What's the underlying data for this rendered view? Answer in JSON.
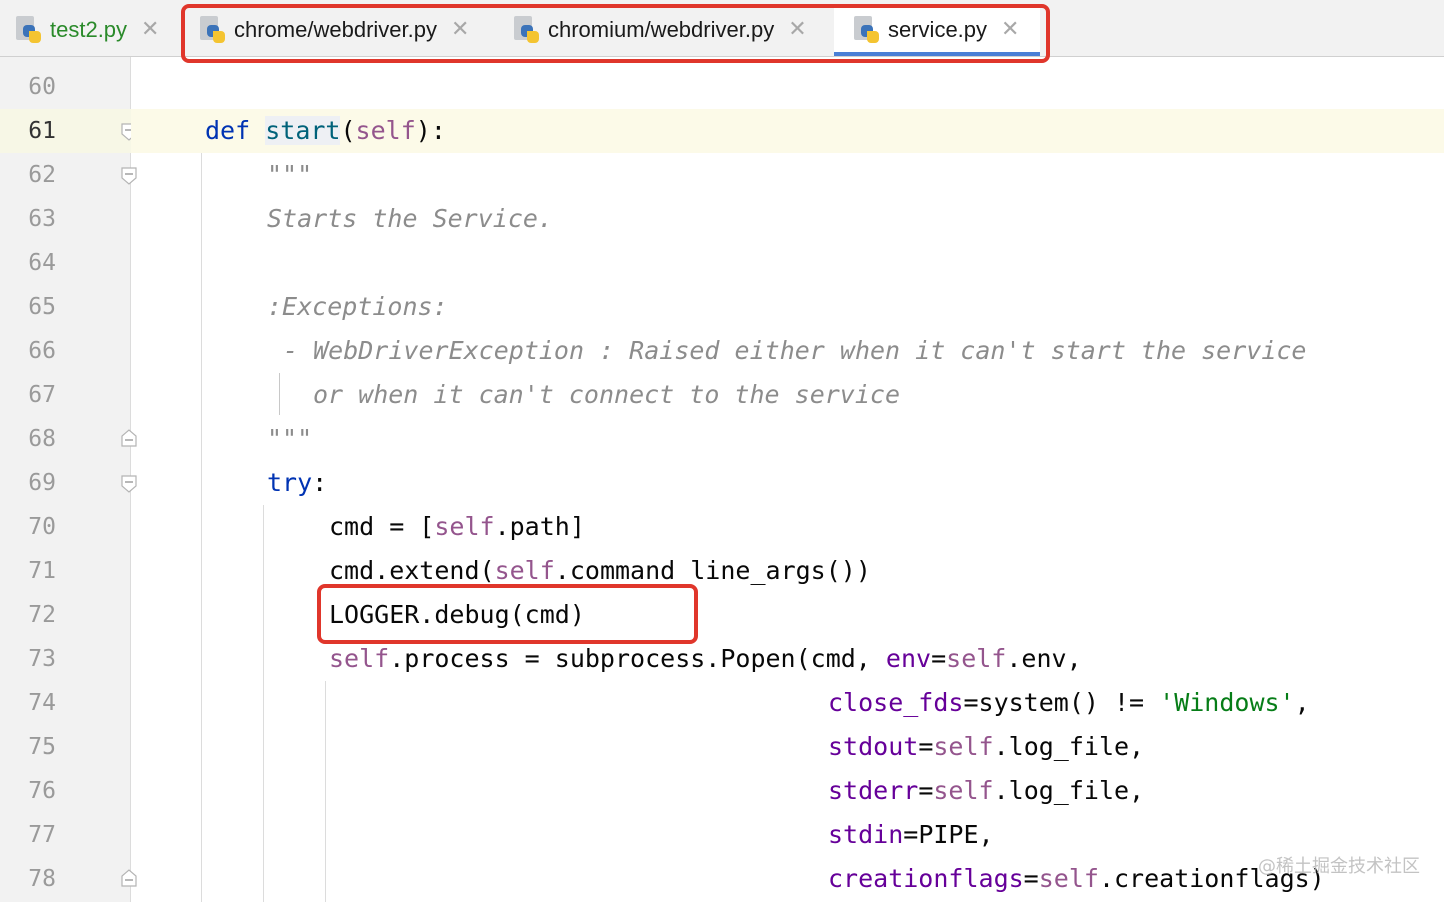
{
  "tabs": [
    {
      "label": "test2.py",
      "active": false
    },
    {
      "label": "chrome/webdriver.py",
      "active": false
    },
    {
      "label": "chromium/webdriver.py",
      "active": false
    },
    {
      "label": "service.py",
      "active": true
    }
  ],
  "editor": {
    "current_line": "61",
    "line_numbers": [
      "60",
      "61",
      "62",
      "63",
      "64",
      "65",
      "66",
      "67",
      "68",
      "69",
      "70",
      "71",
      "72",
      "73",
      "74",
      "75",
      "76",
      "77",
      "78"
    ],
    "code": {
      "l61_def": "def",
      "l61_name": "start",
      "l61_paren_open": "(",
      "l61_self": "self",
      "l61_paren_close": "):",
      "l62_doc": "\"\"\"",
      "l63_doc": "Starts the Service.",
      "l65_doc": ":Exceptions:",
      "l66_doc": "- WebDriverException : Raised either when it can't start the service",
      "l67_doc": "or when it can't connect to the service",
      "l68_doc": "\"\"\"",
      "l69_try": "try",
      "l69_colon": ":",
      "l70_a": "cmd = [",
      "l70_self": "self",
      "l70_b": ".path]",
      "l71_a": "cmd.extend(",
      "l71_self": "self",
      "l71_b": ".command_line_args())",
      "l72": "LOGGER.debug(cmd)",
      "l73_self1": "self",
      "l73_a": ".process = subprocess.Popen(cmd, ",
      "l73_param": "env",
      "l73_eq": "=",
      "l73_self2": "self",
      "l73_b": ".env,",
      "l74_param": "close_fds",
      "l74_a": "=system() != ",
      "l74_str": "'Windows'",
      "l74_b": ",",
      "l75_param": "stdout",
      "l75_eq": "=",
      "l75_self": "self",
      "l75_b": ".log_file,",
      "l76_param": "stderr",
      "l76_eq": "=",
      "l76_self": "self",
      "l76_b": ".log_file,",
      "l77_param": "stdin",
      "l77_a": "=PIPE,",
      "l78_param": "creationflags",
      "l78_eq": "=",
      "l78_self": "self",
      "l78_b": ".creationflags)"
    }
  },
  "watermark": "@稀土掘金技术社区",
  "colors": {
    "highlight_box": "#e0362b",
    "keyword": "#0033b3",
    "function": "#00627a",
    "self": "#94558d",
    "string": "#067d17",
    "param": "#660099",
    "docstring": "#8c8c8c",
    "active_tab_underline": "#4a7fd6"
  }
}
